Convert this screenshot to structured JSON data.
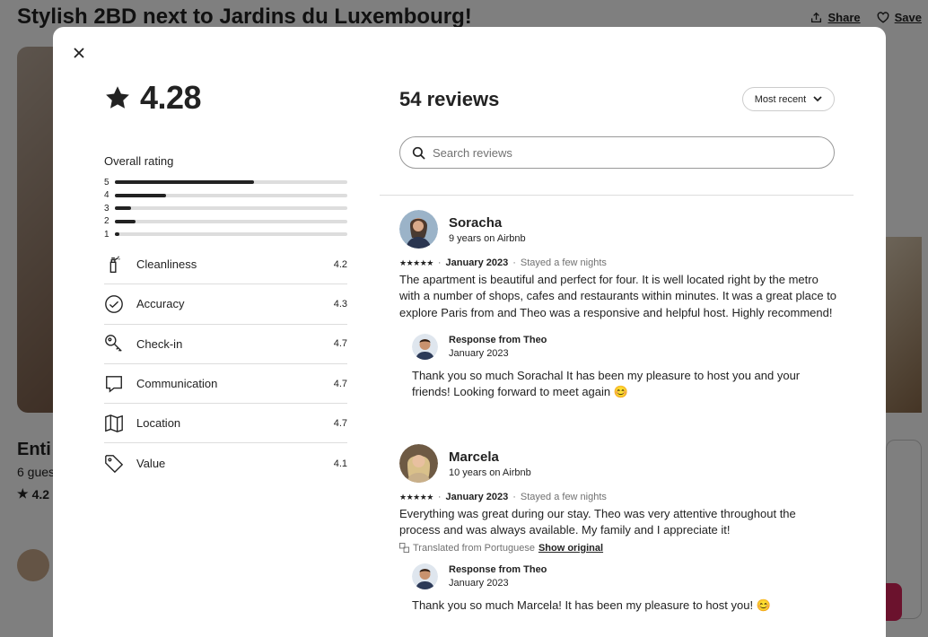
{
  "background": {
    "title": "Stylish 2BD next to Jardins du Luxembourg!",
    "share_label": "Share",
    "save_label": "Save",
    "subtitle_partial": "Enti",
    "guests_partial": "6 gues",
    "rating_partial": "4.2"
  },
  "modal": {
    "overall_score": "4.28",
    "overall_label": "Overall rating",
    "histogram": [
      {
        "star": "5",
        "fraction": 0.6
      },
      {
        "star": "4",
        "fraction": 0.22
      },
      {
        "star": "3",
        "fraction": 0.07
      },
      {
        "star": "2",
        "fraction": 0.09
      },
      {
        "star": "1",
        "fraction": 0.02
      }
    ],
    "categories": [
      {
        "name": "Cleanliness",
        "score": "4.2",
        "icon": "spray-bottle-icon"
      },
      {
        "name": "Accuracy",
        "score": "4.3",
        "icon": "check-circle-icon"
      },
      {
        "name": "Check-in",
        "score": "4.7",
        "icon": "key-icon"
      },
      {
        "name": "Communication",
        "score": "4.7",
        "icon": "message-icon"
      },
      {
        "name": "Location",
        "score": "4.7",
        "icon": "map-icon"
      },
      {
        "name": "Value",
        "score": "4.1",
        "icon": "tag-icon"
      }
    ],
    "reviews_count": "54 reviews",
    "sort_label": "Most recent",
    "search_placeholder": "Search reviews",
    "reviews": [
      {
        "name": "Soracha",
        "tenure": "9 years on Airbnb",
        "stars": "★★★★★",
        "date": "January 2023",
        "stay": "Stayed a few nights",
        "text": "The apartment is beautiful and perfect for four. It is well located right by the metro with a number of shops, cafes and restaurants within minutes. It was a great place to explore Paris from and Theo was a responsive and helpful host. Highly recommend!",
        "response_from": "Response from Theo",
        "response_date": "January 2023",
        "response_text": "Thank you so much Sorachal It has been my pleasure to host you and your friends! Looking forward to meet again 😊"
      },
      {
        "name": "Marcela",
        "tenure": "10 years on Airbnb",
        "stars": "★★★★★",
        "date": "January 2023",
        "stay": "Stayed a few nights",
        "text": "Everything was great during our stay. Theo was very attentive throughout the process and was always available. My family and I appreciate it!",
        "translated_label": "Translated from Portuguese",
        "show_original_label": "Show original",
        "response_from": "Response from Theo",
        "response_date": "January 2023",
        "response_text": "Thank you so much Marcela! It has been my pleasure to host you! 😊"
      }
    ],
    "separator": "·"
  }
}
